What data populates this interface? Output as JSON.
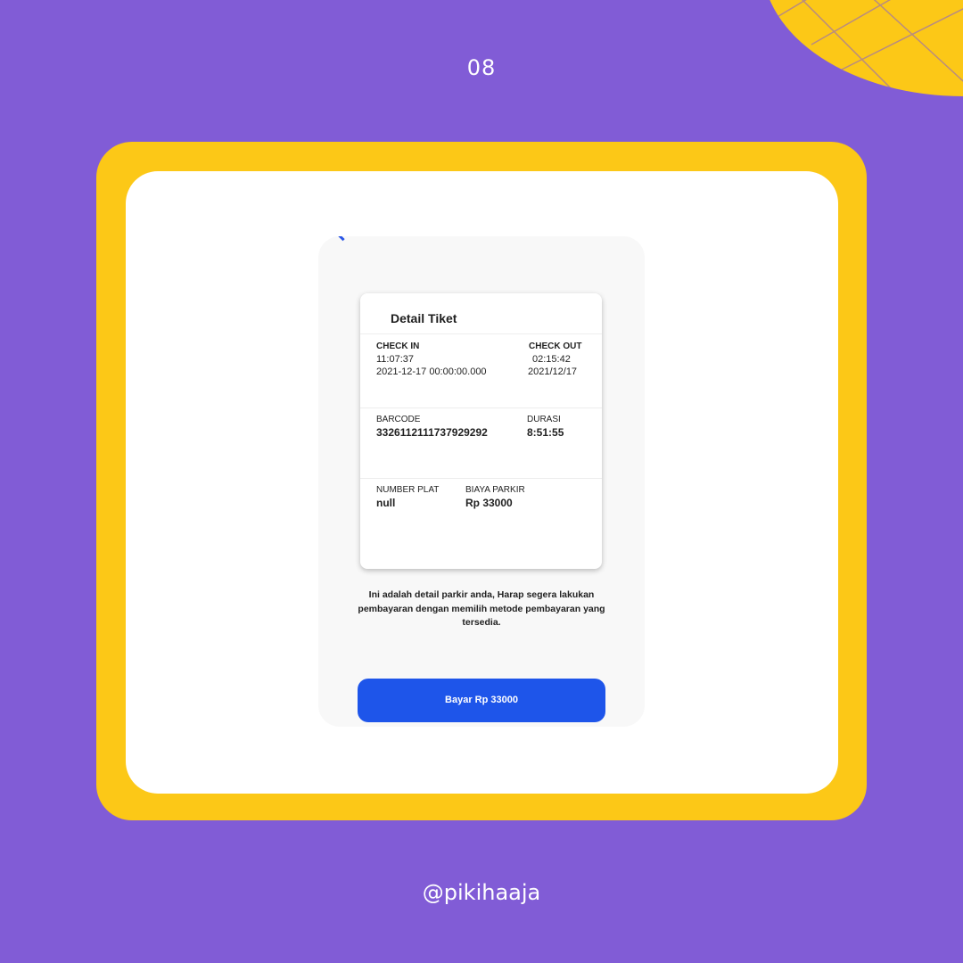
{
  "slide": {
    "page_number": "08",
    "handle": "@pikihaaja",
    "colors": {
      "background": "#815CD6",
      "frame": "#FCC817",
      "button": "#1E55EA"
    }
  },
  "ticket": {
    "title": "Detail Tiket",
    "check_in": {
      "label": "CHECK IN",
      "time": "11:07:37",
      "date": "2021-12-17 00:00:00.000"
    },
    "check_out": {
      "label": "CHECK OUT",
      "time": "02:15:42",
      "date": "2021/12/17"
    },
    "barcode": {
      "label": "BARCODE",
      "value": "3326112111737929292"
    },
    "durasi": {
      "label": "DURASI",
      "value": "8:51:55"
    },
    "number_plat": {
      "label": "NUMBER PLAT",
      "value": "null"
    },
    "biaya_parkir": {
      "label": "BIAYA PARKIR",
      "value": "Rp 33000"
    }
  },
  "note": "Ini adalah detail parkir anda, Harap segera lakukan pembayaran dengan memilih metode pembayaran yang tersedia.",
  "pay_button_label": "Bayar Rp 33000",
  "icons": [
    "back-arrow-icon"
  ]
}
